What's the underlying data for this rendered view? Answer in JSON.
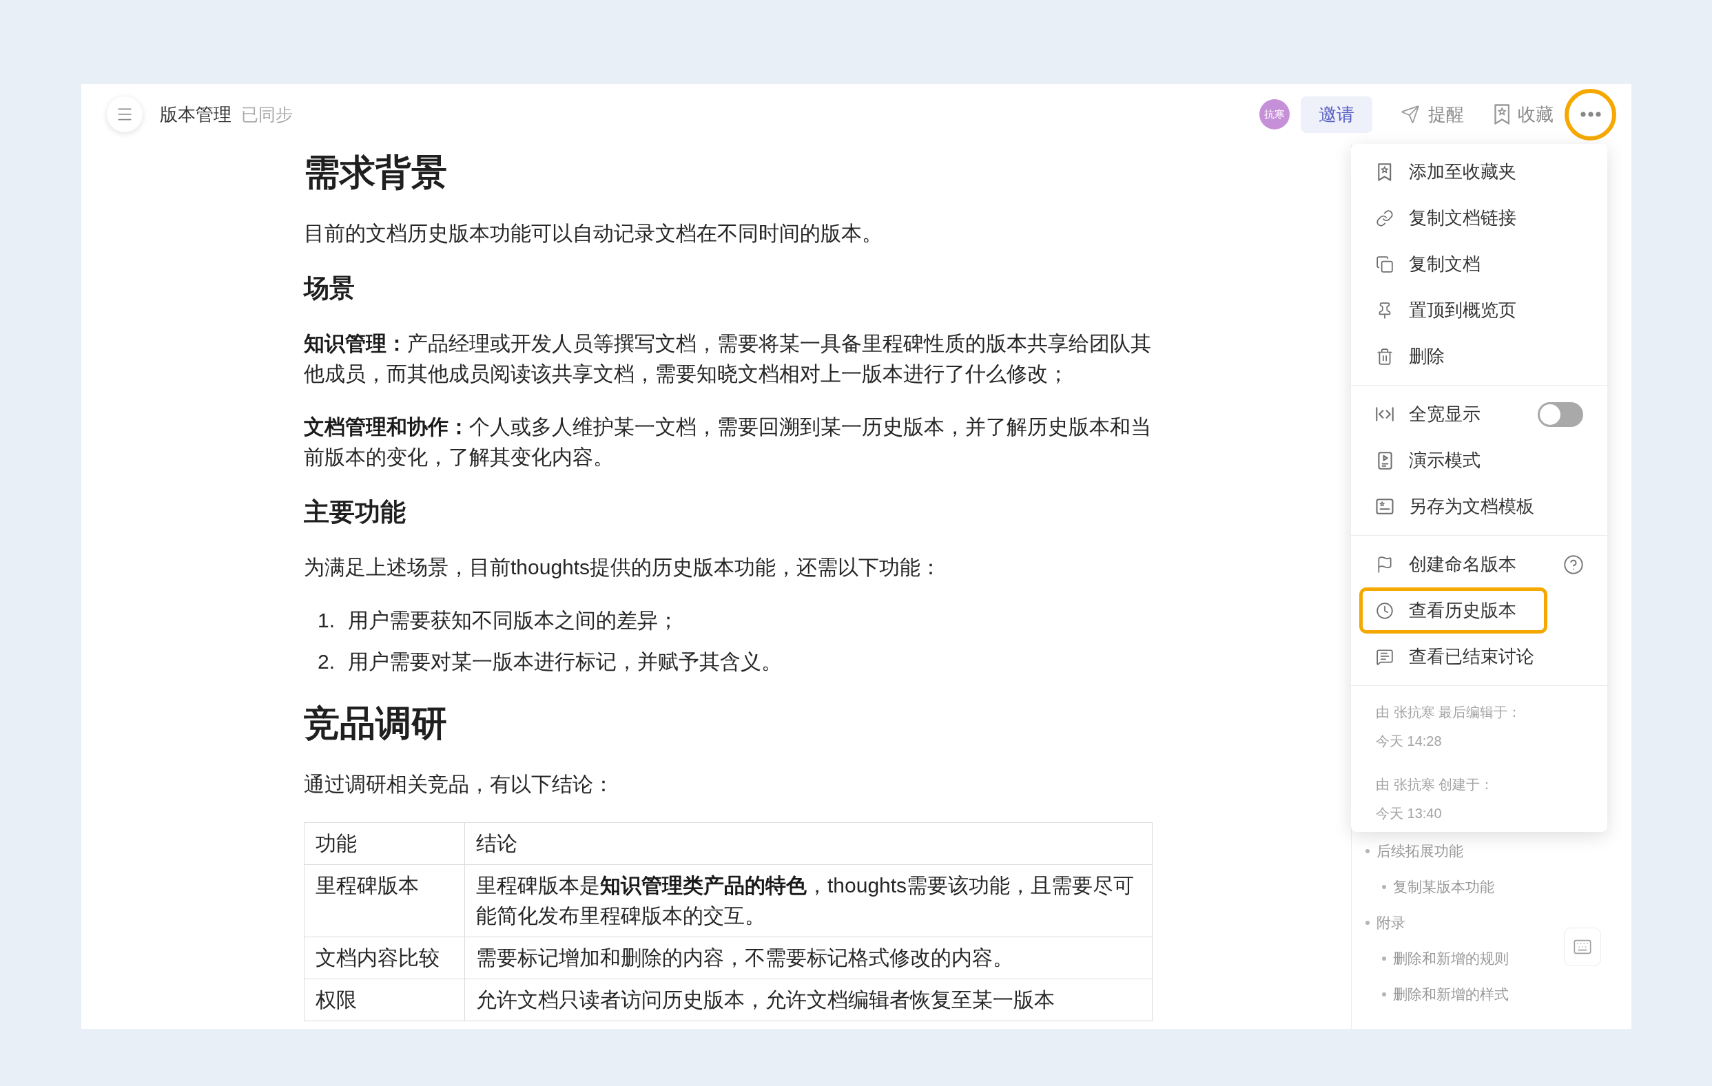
{
  "topbar": {
    "title": "版本管理",
    "sync_status": "已同步",
    "avatar": "抗寒",
    "invite_button": "邀请",
    "actions": [
      {
        "label": "提醒"
      },
      {
        "label": "收藏"
      }
    ],
    "more_button": {
      "highlighted": true
    }
  },
  "document": {
    "blocks": [
      {
        "kind": "h1",
        "text": "需求背景"
      },
      {
        "kind": "paragraph",
        "text": "目前的文档历史版本功能可以自动记录文档在不同时间的版本。"
      },
      {
        "kind": "h2",
        "text": "场景"
      },
      {
        "kind": "paragraph",
        "text": "**知识管理：**产品经理或开发人员等撰写文档，需要将某一具备里程碑性质的版本共享给团队其他成员，而其他成员阅读该共享文档，需要知晓文档相对上一版本进行了什么修改；"
      },
      {
        "kind": "paragraph",
        "text": "**文档管理和协作：**个人或多人维护某一文档，需要回溯到某一历史版本，并了解历史版本和当前版本的变化，了解其变化内容。"
      },
      {
        "kind": "h2",
        "text": "主要功能"
      },
      {
        "kind": "paragraph",
        "text": "为满足上述场景，目前thoughts提供的历史版本功能，还需以下功能："
      },
      {
        "kind": "ordered_list",
        "items": [
          {
            "number": "1.",
            "text": "用户需要获知不同版本之间的差异；"
          },
          {
            "number": "2.",
            "text": "用户需要对某一版本进行标记，并赋予其含义。"
          }
        ]
      },
      {
        "kind": "h1",
        "text": "竞品调研"
      },
      {
        "kind": "paragraph",
        "text": "通过调研相关竞品，有以下结论："
      },
      {
        "kind": "table",
        "columns": [
          "功能",
          "结论"
        ],
        "rows": [
          [
            "里程碑版本",
            "里程碑版本是**知识管理类产品的特色**，thoughts需要该功能，且需要尽可能简化发布里程碑版本的交互。"
          ],
          [
            "文档内容比较",
            "需要标记增加和删除的内容，不需要标记格式修改的内容。"
          ],
          [
            "权限",
            "允许文档只读者访问历史版本，允许文档编辑者恢复至某一版本"
          ]
        ]
      }
    ]
  },
  "menu": {
    "sections": [
      {
        "items": [
          {
            "kind": "plain",
            "label": "添加至收藏夹",
            "highlighted": false
          },
          {
            "kind": "plain",
            "label": "复制文档链接",
            "highlighted": false
          },
          {
            "kind": "plain",
            "label": "复制文档",
            "highlighted": false
          },
          {
            "kind": "plain",
            "label": "置顶到概览页",
            "highlighted": false
          },
          {
            "kind": "plain",
            "label": "删除",
            "highlighted": false
          }
        ]
      },
      {
        "items": [
          {
            "kind": "toggle",
            "label": "全宽显示",
            "on": false,
            "highlighted": false
          },
          {
            "kind": "plain",
            "label": "演示模式",
            "highlighted": false
          },
          {
            "kind": "plain",
            "label": "另存为文档模板",
            "highlighted": false
          }
        ]
      },
      {
        "items": [
          {
            "kind": "help",
            "label": "创建命名版本",
            "highlighted": false
          },
          {
            "kind": "plain",
            "label": "查看历史版本",
            "highlighted": true
          },
          {
            "kind": "plain",
            "label": "查看已结束讨论",
            "highlighted": false
          }
        ]
      }
    ],
    "info": [
      {
        "label": "由 张抗寒 最后编辑于：",
        "time": "今天 14:28"
      },
      {
        "label": "由 张抗寒 创建于：",
        "time": "今天 13:40"
      }
    ]
  },
  "outline": {
    "items": [
      {
        "label": "后续拓展功能",
        "children": [
          {
            "label": "复制某版本功能"
          }
        ]
      },
      {
        "label": "附录",
        "children": [
          {
            "label": "删除和新增的规则"
          },
          {
            "label": "删除和新增的样式"
          }
        ]
      }
    ]
  }
}
